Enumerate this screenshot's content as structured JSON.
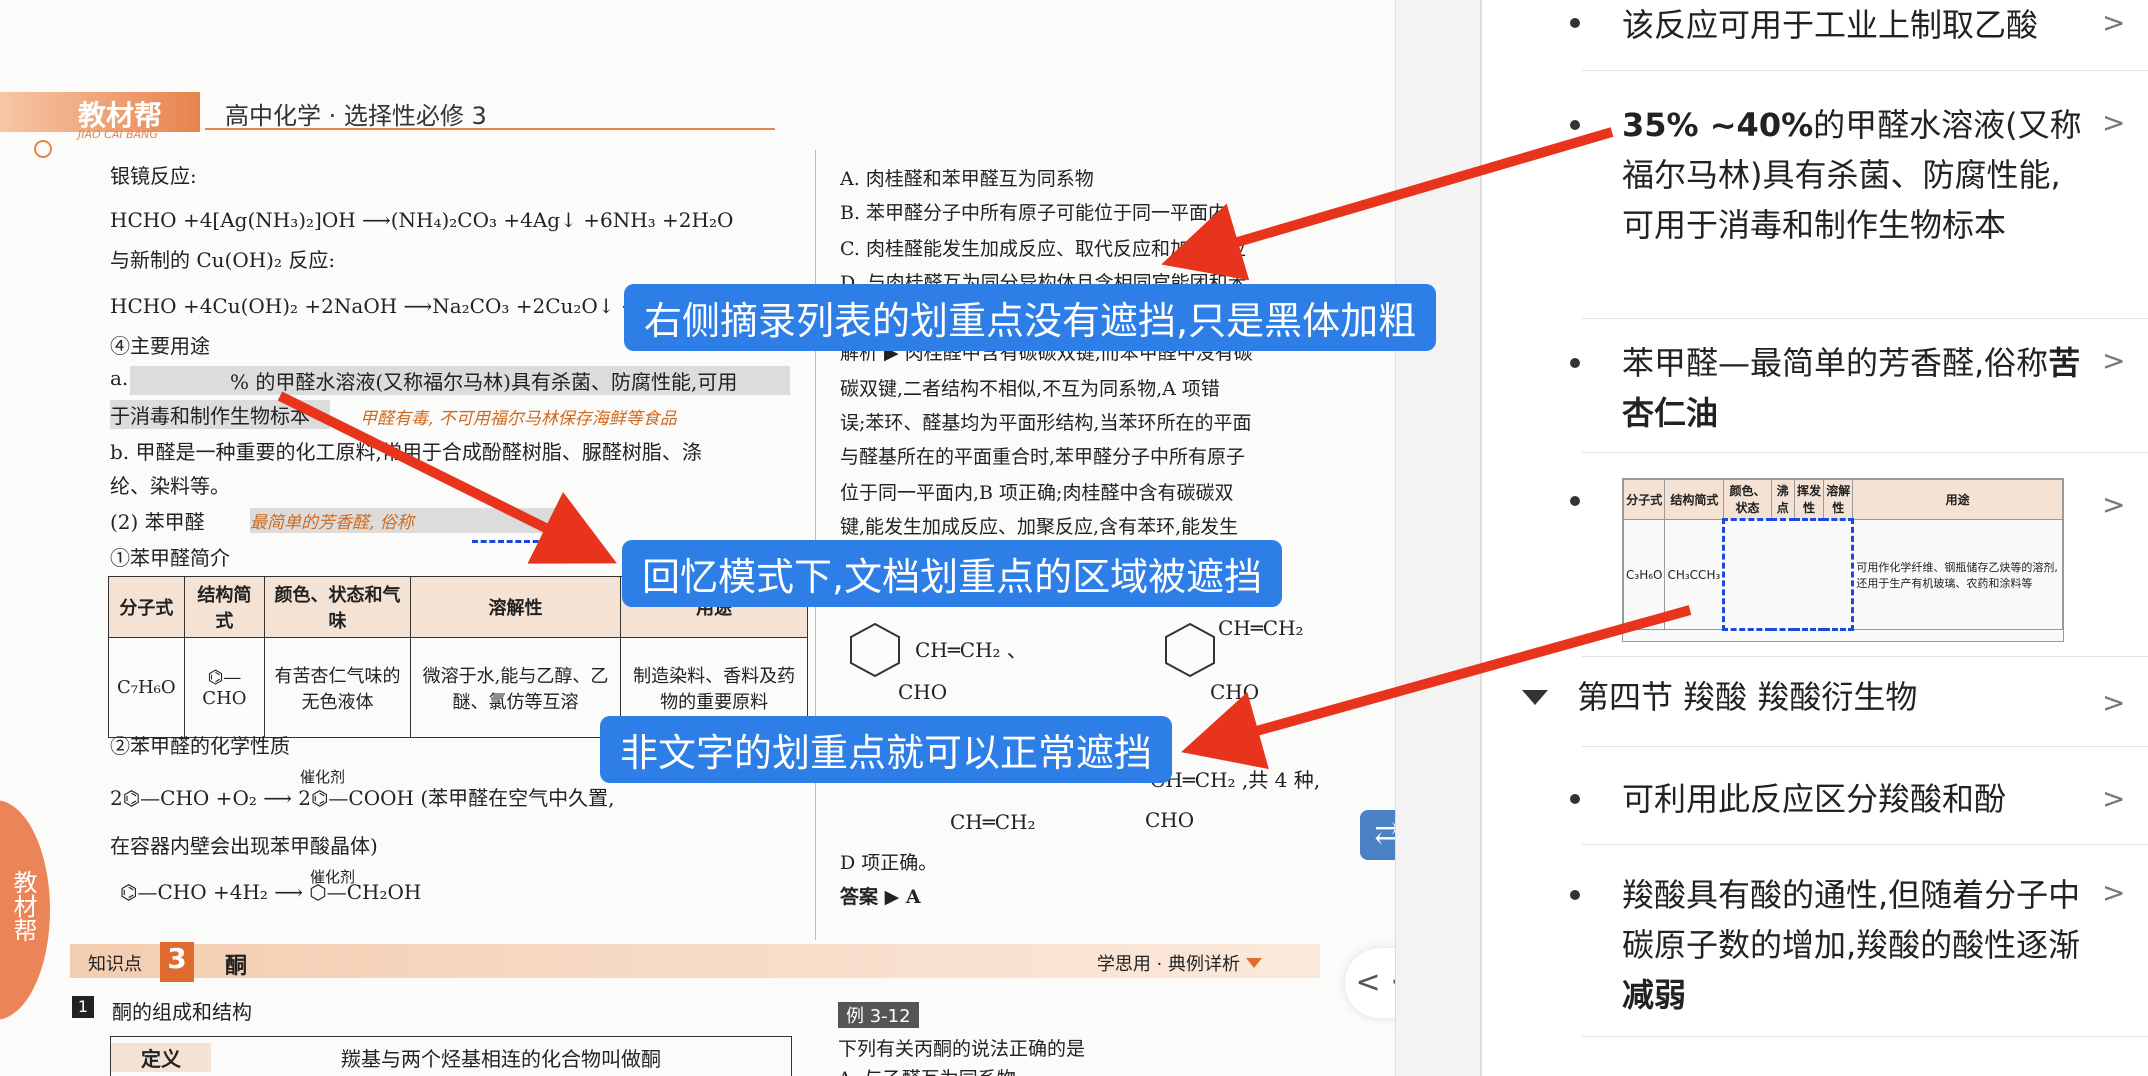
{
  "book": {
    "brand": "教材帮",
    "brand_en": "JIAO CAI BANG",
    "title": "高中化学 · 选择性必修 3"
  },
  "left_col": {
    "l1": "银镜反应:",
    "l2": "HCHO +4[Ag(NH₃)₂]OH ⟶(NH₄)₂CO₃ +4Ag↓ +6NH₃ +2H₂O",
    "l3": "与新制的 Cu(OH)₂ 反应:",
    "l4": "HCHO +4Cu(OH)₂ +2NaOH ⟶Na₂CO₃ +2Cu₂O↓ +",
    "l5": "④主要用途",
    "l6a": "a.",
    "l6b": "% 的甲醛水溶液(又称福尔马林)具有杀菌、防腐性能,可用",
    "l7": "于消毒和制作生物标本",
    "note1": "甲醛有毒, 不可用福尔马林保存海鲜等食品",
    "l8": "b. 甲醛是一种重要的化工原料,常用于合成酚醛树脂、脲醛树脂、涤",
    "l9": "纶、染料等。",
    "l10": "(2) 苯甲醛",
    "note2": "最简单的芳香醛, 俗称",
    "l11": "①苯甲醛简介",
    "table_head": [
      "分子式",
      "结构简式",
      "颜色、状态和气味",
      "溶解性",
      "用途"
    ],
    "table_row": [
      "C₇H₆O",
      "⌬—CHO",
      "有苦杏仁气味的无色液体",
      "微溶于水,能与乙醇、乙醚、氯仿等互溶",
      "制造染料、香料及药物的重要原料"
    ],
    "l12": "②苯甲醛的化学性质",
    "l13": "2⌬—CHO +O₂ ⟶ 2⌬—COOH (苯甲醛在空气中久置,",
    "l13c": "催化剂",
    "l14": "在容器内壁会出现苯甲酸晶体)",
    "l15": "⌬—CHO +4H₂ ⟶ ⬡—CH₂OH",
    "l15c": "催化剂"
  },
  "right_col": {
    "a": "A. 肉桂醛和苯甲醛互为同系物",
    "b": "B. 苯甲醛分子中所有原子可能位于同一平面内",
    "c": "C. 肉桂醛能发生加成反应、取代反应和加聚反应",
    "d": "D. 与肉桂醛互为同分异构体且含相同官能团和苯",
    "p1": "解析 ▶ 肉桂醛中含有碳碳双键,而苯甲醛中没有碳",
    "p2": "碳双键,二者结构不相似,不互为同系物,A 项错",
    "p3": "误;苯环、醛基均为平面形结构,当苯环所在的平面",
    "p4": "与醛基所在的平面重合时,苯甲醛分子中所有原子",
    "p5": "位于同一平面内,B 项正确;肉桂醛中含有碳碳双",
    "p6": "键,能发生加成反应、加聚反应,含有苯环,能发生",
    "s1": "CH═CH₂ 、",
    "s2": "CH═CH₂",
    "s3": "CHO",
    "s4": "CHO",
    "s5": "CH═CH₂ ,共 4 种,",
    "s6": "CH═CH₂",
    "s7": "CHO",
    "end": "D 项正确。",
    "answer": "答案 ▶ A"
  },
  "knowledge": {
    "label": "知识点",
    "num": "3",
    "title": "酮",
    "right": "学思用 · 典例详析"
  },
  "bottom": {
    "h1": "酮的组成和结构",
    "def_label": "定义",
    "def_text": "羰基与两个烃基相连的化合物叫做酮",
    "ex": "例 3-12",
    "q": "下列有关丙酮的说法正确的是",
    "q2": "A. 与乙醛互为同系物"
  },
  "side_badge": "教材帮",
  "annotations": {
    "a1": "右侧摘录列表的划重点没有遮挡,只是黑体加粗",
    "a2": "回忆模式下,文档划重点的区域被遮挡",
    "a3": "非文字的划重点就可以正常遮挡"
  },
  "excerpts": {
    "i1": "该反应可用于工业上制取乙酸",
    "i2_bold": "35% ~40%",
    "i2": "的甲醛水溶液(又称福尔马林)具有杀菌、防腐性能,可用于消毒和制作生物标本",
    "i3": "苯甲醛—最简单的芳香醛,俗称",
    "i3_bold": "苦杏仁油",
    "mini_head": [
      "分子式",
      "结构简式",
      "颜色、状态",
      "沸点",
      "挥发性",
      "溶解性",
      "用途"
    ],
    "mini_c1": "C₃H₆O",
    "mini_c2": "CH₃CCH₃",
    "mini_use": "可用作化学纤维、钢瓶储存乙炔等的溶剂,还用于生产有机玻璃、农药和涂料等",
    "section": "第四节 羧酸 羧酸衍生物",
    "i4": "可利用此反应区分羧酸和酚",
    "i5": "羧酸具有酸的通性,但随着分子中碳原子数的增加,羧酸的酸性逐渐",
    "i5_bold": "减弱",
    "chevron": ">"
  },
  "nav": {
    "label": "< · >"
  },
  "colors": {
    "accent": "#2d7ee6",
    "arrow": "#e8341c",
    "brand": "#e7834d",
    "dash": "#1b49e0"
  }
}
